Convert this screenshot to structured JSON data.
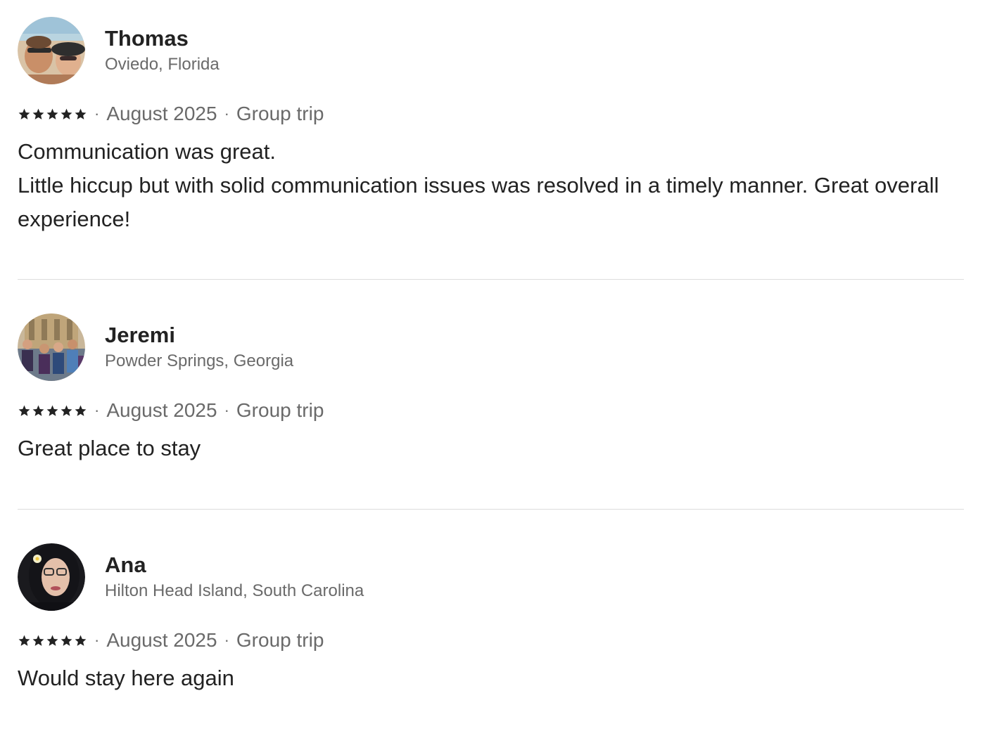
{
  "reviews": [
    {
      "name": "Thomas",
      "location": "Oviedo, Florida",
      "rating": 5,
      "date": "August 2025",
      "trip_type": "Group trip",
      "text": "Communication was great.\nLittle hiccup but with solid communication issues was resolved in a timely manner. Great overall experience!"
    },
    {
      "name": "Jeremi",
      "location": "Powder Springs, Georgia",
      "rating": 5,
      "date": "August 2025",
      "trip_type": "Group trip",
      "text": "Great place to stay"
    },
    {
      "name": "Ana",
      "location": "Hilton Head Island, South Carolina",
      "rating": 5,
      "date": "August 2025",
      "trip_type": "Group trip",
      "text": "Would stay here again"
    }
  ],
  "separator": "·",
  "icons": {
    "star": "star-icon"
  },
  "colors": {
    "text": "#222222",
    "muted": "#6a6a6a",
    "divider": "#dddddd"
  }
}
